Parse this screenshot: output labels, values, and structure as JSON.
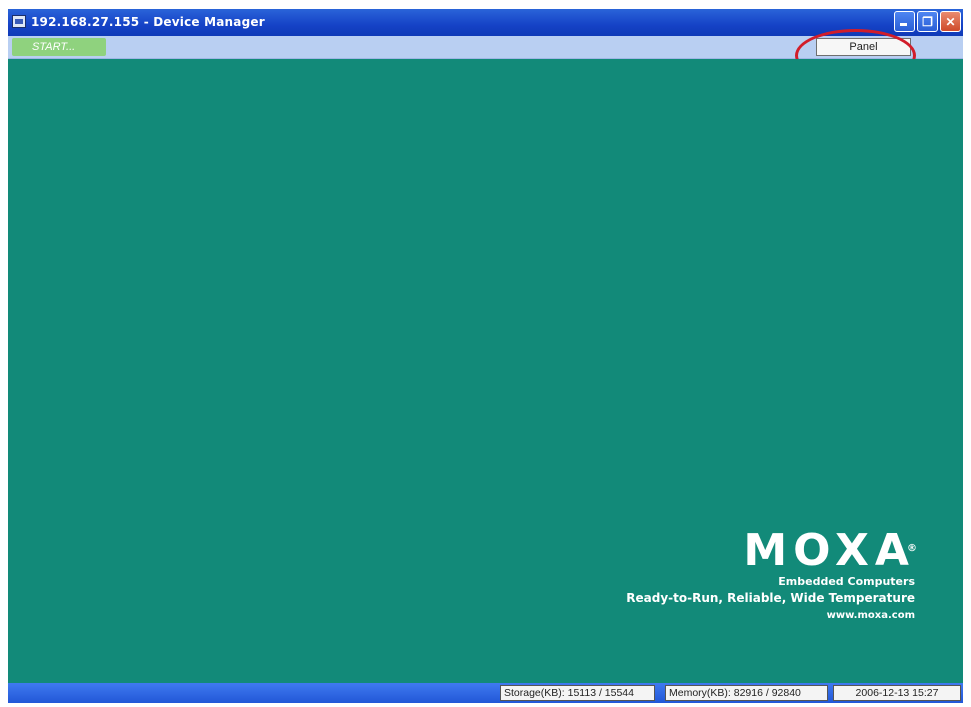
{
  "window": {
    "title": "192.168.27.155 - Device Manager",
    "icons": [
      "app-icon",
      "minimize-icon",
      "maximize-icon",
      "close-icon"
    ]
  },
  "toolbar": {
    "start_label": "START...",
    "panel_label": "Panel",
    "annotation_color": "#d21d2a"
  },
  "logo": {
    "wordmark": "MOXA",
    "registered": "®",
    "line1": "Embedded Computers",
    "line2": "Ready-to-Run, Reliable, Wide Temperature",
    "url": "www.moxa.com"
  },
  "statusbar": {
    "storage": "Storage(KB): 15113 / 15544",
    "memory": "Memory(KB): 82916 / 92840",
    "datetime": "2006-12-13 15:27"
  },
  "colors": {
    "desktop": "#128a79",
    "titlebar": "#1542c6",
    "strip": "#b9cff2",
    "start": "#8fd27e"
  }
}
